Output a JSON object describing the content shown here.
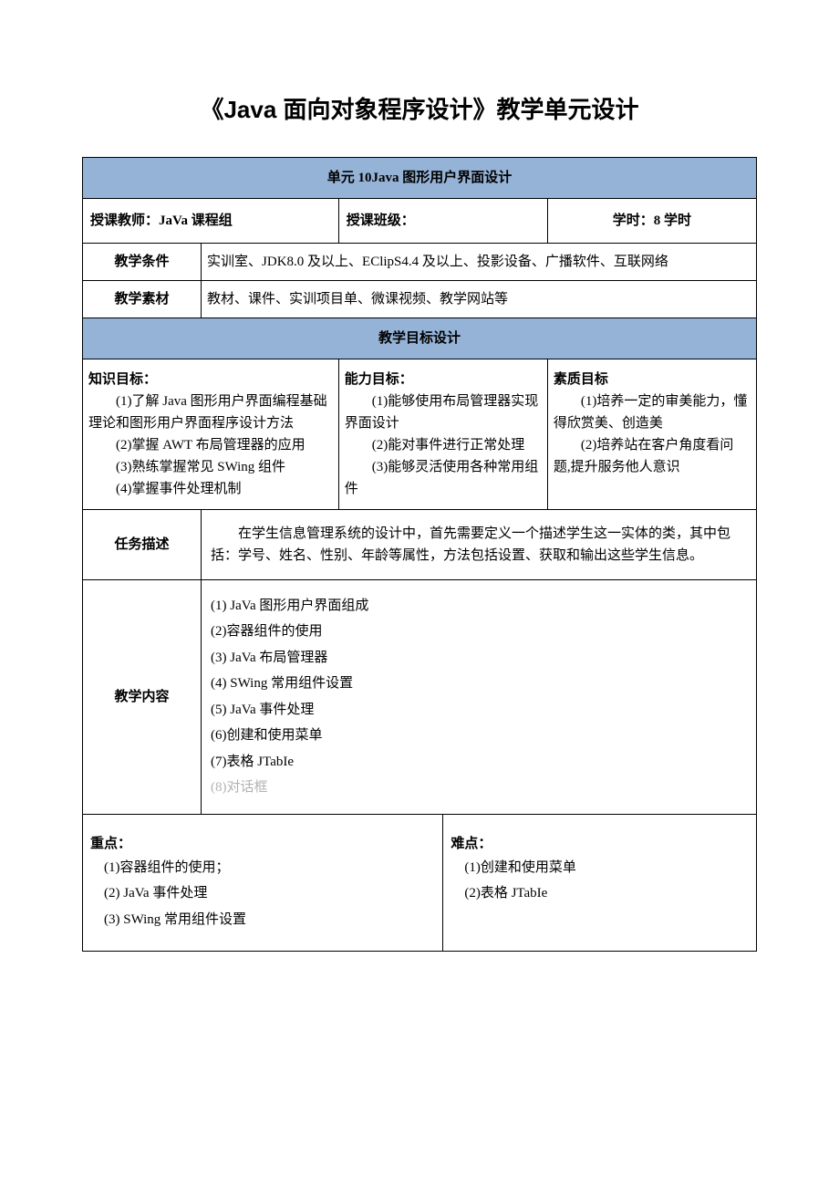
{
  "title": "《Java 面向对象程序设计》教学单元设计",
  "unitHeader": "单元 10Java 图形用户界面设计",
  "meta": {
    "teacherLabel": "授课教师：",
    "teacherValue": "JaVa 课程组",
    "classLabel": "授课班级：",
    "classValue": "",
    "hoursLabel": "学时：",
    "hoursValue": "8 学时"
  },
  "conditions": {
    "label": "教学条件",
    "value": "实训室、JDK8.0 及以上、EClipS4.4 及以上、投影设备、广播软件、互联网络"
  },
  "materials": {
    "label": "教学素材",
    "value": "教材、课件、实训项目单、微课视频、教学网站等"
  },
  "goalsHeader": "教学目标设计",
  "goals": {
    "knowledge": {
      "title": "知识目标：",
      "items": [
        "(1)了解 Java 图形用户界面编程基础理论和图形用户界面程序设计方法",
        "(2)掌握 AWT 布局管理器的应用",
        "(3)熟练掌握常见 SWing 组件",
        "(4)掌握事件处理机制"
      ]
    },
    "ability": {
      "title": "能力目标：",
      "items": [
        "(1)能够使用布局管理器实现界面设计",
        "(2)能对事件进行正常处理",
        "(3)能够灵活使用各种常用组件"
      ]
    },
    "quality": {
      "title": "素质目标",
      "items": [
        "(1)培养一定的审美能力，懂得欣赏美、创造美",
        "(2)培养站在客户角度看问题,提升服务他人意识"
      ]
    }
  },
  "task": {
    "label": "任务描述",
    "value": "在学生信息管理系统的设计中，首先需要定义一个描述学生这一实体的类，其中包括：学号、姓名、性别、年龄等属性，方法包括设置、获取和输出这些学生信息。"
  },
  "content": {
    "label": "教学内容",
    "items": [
      "(1) JaVa 图形用户界面组成",
      "(2)容器组件的使用",
      "(3)  JaVa 布局管理器",
      "(4)  SWing 常用组件设置",
      "(5)  JaVa 事件处理",
      "(6)创建和使用菜单",
      "(7)表格 JTabIe",
      "(8)对话框"
    ]
  },
  "focus": {
    "title": "重点：",
    "items": [
      "(1)容器组件的使用；",
      "(2)  JaVa 事件处理",
      "(3)  SWing 常用组件设置"
    ]
  },
  "difficulty": {
    "title": "难点：",
    "items": [
      "(1)创建和使用菜单",
      "(2)表格 JTabIe"
    ]
  }
}
